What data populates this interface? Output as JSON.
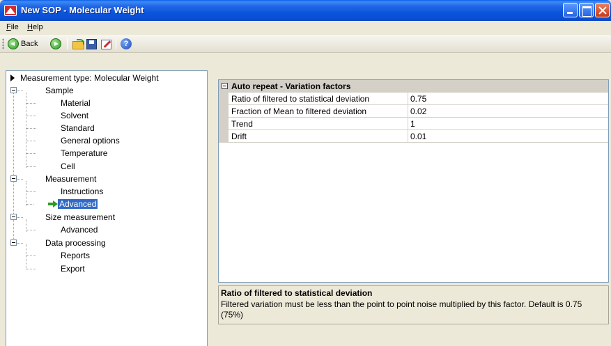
{
  "window": {
    "title": "New SOP - Molecular Weight"
  },
  "menu": {
    "file_u": "F",
    "file_rest": "ile",
    "help_u": "H",
    "help_rest": "elp"
  },
  "toolbar": {
    "back_label": "Back",
    "icons": [
      "back-arrow-icon",
      "forward-arrow-icon",
      "open-folder-icon",
      "save-icon",
      "edit-icon",
      "help-icon"
    ]
  },
  "tree": {
    "root": "Measurement type: Molecular Weight",
    "sample": {
      "label": "Sample",
      "children": [
        "Material",
        "Solvent",
        "Standard",
        "General options",
        "Temperature",
        "Cell"
      ]
    },
    "measurement": {
      "label": "Measurement",
      "children": [
        "Instructions",
        "Advanced"
      ],
      "selected": "Advanced"
    },
    "size_measurement": {
      "label": "Size measurement",
      "children": [
        "Advanced"
      ]
    },
    "data_processing": {
      "label": "Data processing",
      "children": [
        "Reports",
        "Export"
      ]
    }
  },
  "property_grid": {
    "category": "Auto repeat - Variation factors",
    "rows": [
      {
        "name": "Ratio of filtered to statistical deviation",
        "value": "0.75"
      },
      {
        "name": "Fraction of Mean to filtered deviation",
        "value": "0.02"
      },
      {
        "name": "Trend",
        "value": "1"
      },
      {
        "name": "Drift",
        "value": "0.01"
      }
    ]
  },
  "description": {
    "title": "Ratio of filtered to statistical deviation",
    "text": "Filtered variation must be less than the point to point noise multiplied by this factor.   Default is 0.75 (75%)"
  },
  "colors": {
    "titlebar": "#0A5FE8",
    "selection": "#316AC5",
    "window_bg": "#ECE9D8"
  }
}
